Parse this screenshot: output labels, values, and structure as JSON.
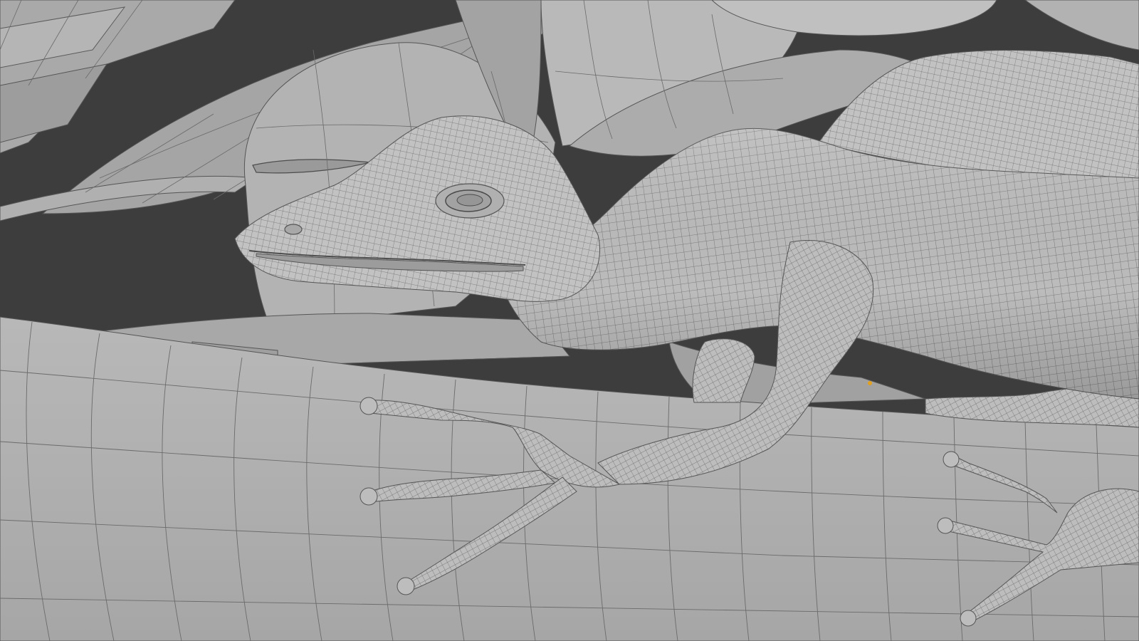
{
  "viewport": {
    "kind": "3d-viewport-solid-wireframe",
    "subject": "lizard-on-branch",
    "colors": {
      "background": "#3d3d3d",
      "mesh_light": "#bdbdbd",
      "mesh_mid": "#a9a9a9",
      "mesh_dark": "#8c8c8c",
      "wire": "#5b5b5b",
      "origin_dot": "#e0a020"
    },
    "elements": [
      {
        "name": "leaf",
        "icon": "leaf-shape"
      },
      {
        "name": "branch",
        "icon": "cylinder-shape"
      },
      {
        "name": "lizard-body",
        "icon": "lizard-shape"
      },
      {
        "name": "lizard-head",
        "icon": "lizard-head-shape"
      },
      {
        "name": "lizard-eye",
        "icon": "eye-shape"
      },
      {
        "name": "lizard-front-leg",
        "icon": "limb-shape"
      },
      {
        "name": "lizard-foot",
        "icon": "foot-shape"
      },
      {
        "name": "object-origin",
        "icon": "origin-dot"
      }
    ]
  }
}
